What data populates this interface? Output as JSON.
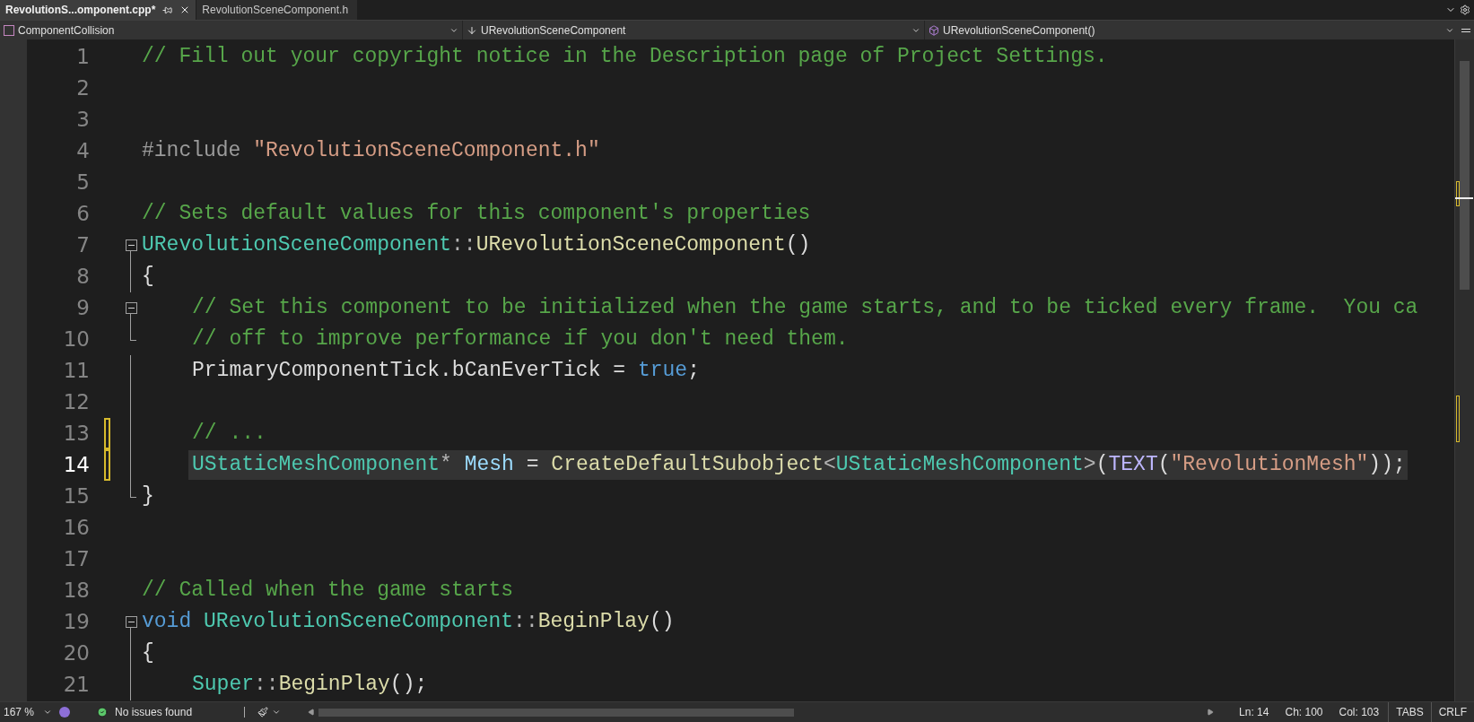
{
  "tabs": [
    {
      "label": "RevolutionS...omponent.cpp*",
      "selected": true
    },
    {
      "label": "RevolutionSceneComponent.h",
      "selected": false
    }
  ],
  "nav_bar": {
    "scope": "ComponentCollision",
    "type": "URevolutionSceneComponent",
    "member": "URevolutionSceneComponent()"
  },
  "editor": {
    "lines": [
      {
        "number": "1",
        "current": false,
        "changed": false,
        "indented": false,
        "kind": "plain",
        "tokens": [
          {
            "kind": "comment",
            "text": "// Fill out your copyright notice in the Description page of Project Settings."
          }
        ]
      },
      {
        "number": "2",
        "current": false,
        "changed": false,
        "kind": "plain"
      },
      {
        "number": "3",
        "current": false,
        "changed": false,
        "kind": "plain"
      },
      {
        "number": "4",
        "current": false,
        "changed": false,
        "indented": false,
        "kind": "plain",
        "tokens": [
          {
            "kind": "preproc",
            "text": "#include"
          },
          {
            "kind": "string",
            "text": "\"RevolutionSceneComponent.h\""
          }
        ]
      },
      {
        "number": "5",
        "current": false,
        "changed": false,
        "kind": "plain"
      },
      {
        "number": "6",
        "current": false,
        "changed": false,
        "indented": false,
        "kind": "plain",
        "tokens": [
          {
            "kind": "comment",
            "text": "// Sets default values for this component's properties"
          }
        ]
      },
      {
        "number": "7",
        "current": false,
        "changed": false,
        "indented": false,
        "kind": "fold-start",
        "tokens": [
          {
            "kind": "type",
            "text": "URevolutionSceneComponent"
          },
          {
            "kind": "punct",
            "text": "::"
          },
          {
            "kind": "func",
            "text": "URevolutionSceneComponent"
          },
          {
            "kind": "plain",
            "text": "()"
          }
        ]
      },
      {
        "number": "8",
        "current": false,
        "changed": false,
        "indented": false,
        "kind": "in-block",
        "tokens": [
          {
            "kind": "plain",
            "text": "{"
          }
        ]
      },
      {
        "number": "9",
        "current": false,
        "changed": false,
        "indented": true,
        "kind": "fold-start",
        "tokens": [
          {
            "kind": "comment",
            "text": "// Set this component to be initialized when the game starts, and to be ticked every frame.  You ca"
          }
        ]
      },
      {
        "number": "10",
        "current": false,
        "changed": false,
        "indented": true,
        "kind": "block-end",
        "tokens": [
          {
            "kind": "comment",
            "text": "// off to improve performance if you don't need them."
          }
        ]
      },
      {
        "number": "11",
        "current": false,
        "changed": false,
        "indented": true,
        "kind": "in-block",
        "tokens": [
          {
            "kind": "plain",
            "text": "PrimaryComponentTick.bCanEverTick ="
          },
          {
            "kind": "keyword",
            "text": "true"
          },
          {
            "kind": "plain",
            "text": ";"
          }
        ]
      },
      {
        "number": "12",
        "current": false,
        "changed": false,
        "kind": "in-block"
      },
      {
        "number": "13",
        "current": false,
        "changed": true,
        "indented": true,
        "kind": "in-block",
        "tokens": [
          {
            "kind": "comment",
            "text": "// ..."
          }
        ]
      },
      {
        "number": "14",
        "current": true,
        "changed": true,
        "indented": true,
        "kind": "in-block",
        "tokens": [
          {
            "kind": "type",
            "text": "UStaticMeshComponent"
          },
          {
            "kind": "punct",
            "text": "*"
          },
          {
            "kind": "variable",
            "text": "Mesh"
          },
          {
            "kind": "plain",
            "text": "="
          },
          {
            "kind": "func",
            "text": "CreateDefaultSubobject"
          },
          {
            "kind": "punct",
            "text": "<"
          },
          {
            "kind": "type",
            "text": "UStaticMeshComponent"
          },
          {
            "kind": "punct",
            "text": ">"
          },
          {
            "kind": "plain",
            "text": "("
          },
          {
            "kind": "macro",
            "text": "TEXT"
          },
          {
            "kind": "plain",
            "text": "("
          },
          {
            "kind": "string",
            "text": "\"RevolutionMesh\""
          },
          {
            "kind": "plain",
            "text": "));"
          }
        ]
      },
      {
        "number": "15",
        "current": false,
        "changed": false,
        "indented": false,
        "kind": "block-end",
        "tokens": [
          {
            "kind": "plain",
            "text": "}"
          }
        ]
      },
      {
        "number": "16",
        "current": false,
        "changed": false,
        "kind": "plain"
      },
      {
        "number": "17",
        "current": false,
        "changed": false,
        "kind": "plain"
      },
      {
        "number": "18",
        "current": false,
        "changed": false,
        "indented": false,
        "kind": "plain",
        "tokens": [
          {
            "kind": "comment",
            "text": "// Called when the game starts"
          }
        ]
      },
      {
        "number": "19",
        "current": false,
        "changed": false,
        "indented": false,
        "kind": "fold-start",
        "tokens": [
          {
            "kind": "keyword",
            "text": "void"
          },
          {
            "kind": "type",
            "text": "URevolutionSceneComponent"
          },
          {
            "kind": "punct",
            "text": "::"
          },
          {
            "kind": "func",
            "text": "BeginPlay"
          },
          {
            "kind": "plain",
            "text": "()"
          }
        ]
      },
      {
        "number": "20",
        "current": false,
        "changed": false,
        "indented": false,
        "kind": "in-block",
        "tokens": [
          {
            "kind": "plain",
            "text": "{"
          }
        ]
      },
      {
        "number": "21",
        "current": false,
        "changed": false,
        "indented": true,
        "kind": "in-block",
        "tokens": [
          {
            "kind": "type",
            "text": "Super"
          },
          {
            "kind": "punct",
            "text": "::"
          },
          {
            "kind": "func",
            "text": "BeginPlay"
          },
          {
            "kind": "plain",
            "text": "();"
          }
        ]
      }
    ]
  },
  "status_bar": {
    "zoom": "167 %",
    "issues": "No issues found",
    "line": "Ln: 14",
    "char": "Ch: 100",
    "column": "Col: 103",
    "indent": "TABS",
    "line_ending": "CRLF"
  }
}
